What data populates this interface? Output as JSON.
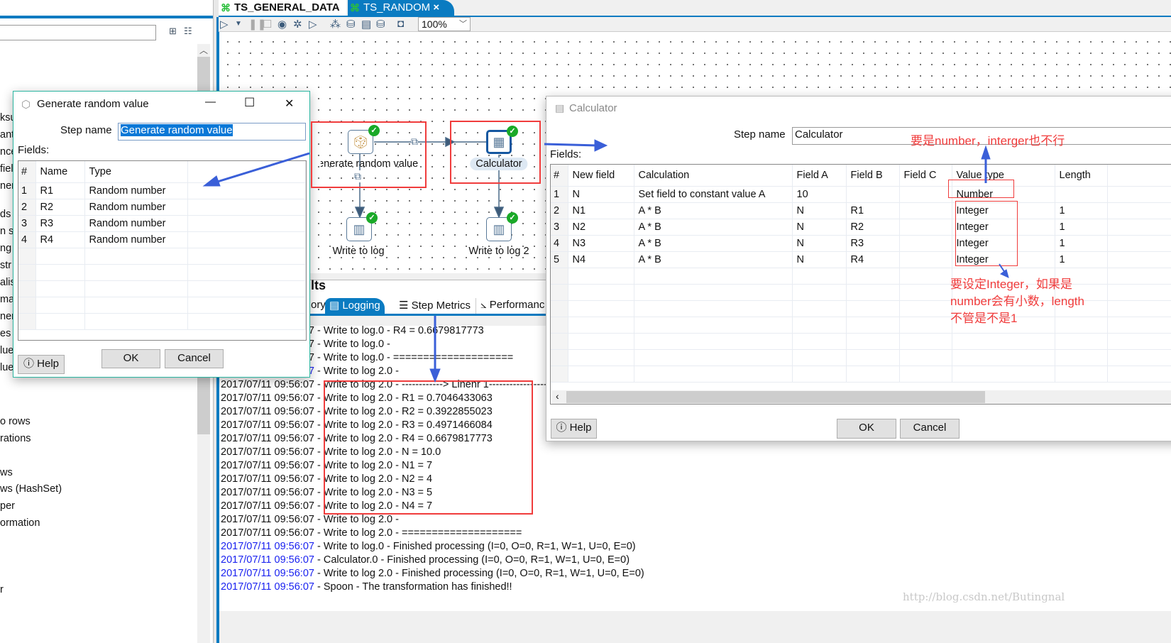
{
  "left_panel": {
    "items_top": [
      "ksu",
      "ant",
      "nce",
      "fiel",
      "ner",
      "ds",
      "n sl",
      "ng",
      "str",
      "alis",
      "ma",
      "ner",
      "es",
      "lue",
      "lue"
    ],
    "items_bottom": [
      "o rows",
      "rations",
      "ws",
      "ws (HashSet)",
      "per",
      "ormation",
      "r"
    ]
  },
  "tabs": [
    {
      "label": "TS_GENERAL_DATA",
      "active": false
    },
    {
      "label": "TS_RANDOM",
      "active": true,
      "close": "×"
    }
  ],
  "toolbar": {
    "zoom": "100%",
    "icons": [
      "run-icon",
      "dropdown-icon",
      "pause-icon",
      "stop-icon",
      "preview-icon",
      "debug-icon",
      "replay-icon",
      "verify-icon",
      "impact-icon",
      "sql-icon",
      "explore-db-icon",
      "show-results-icon"
    ]
  },
  "canvas": {
    "steps": [
      {
        "label": "Generate random value",
        "icon": "dice-icon"
      },
      {
        "label": "Calculator",
        "icon": "calculator-icon"
      },
      {
        "label": "Write to log",
        "icon": "log-icon"
      },
      {
        "label": "Write to log 2",
        "icon": "log-icon"
      }
    ]
  },
  "results": {
    "title": "lts",
    "tabs": [
      "ory",
      "Logging",
      "Step Metrics",
      "Performanc"
    ],
    "log": [
      {
        "ts": "2017/07/11 09:56:07",
        "blue": false,
        "text": " - Write to log.0 - R4 = 0.6679817773"
      },
      {
        "ts": "2017/07/11 09:56:07",
        "blue": false,
        "text": " - Write to log.0 - "
      },
      {
        "ts": "2017/07/11 09:56:07",
        "blue": false,
        "text": " - Write to log.0 - ===================="
      },
      {
        "ts": "2017/07/11 09:56:07",
        "blue": true,
        "text": " - Write to log 2.0 - "
      },
      {
        "ts": "2017/07/11 09:56:07",
        "blue": false,
        "text": " - Write to log 2.0 - ------------> Linenr 1------------------------"
      },
      {
        "ts": "2017/07/11 09:56:07",
        "blue": false,
        "text": " - Write to log 2.0 - R1 = 0.7046433063"
      },
      {
        "ts": "2017/07/11 09:56:07",
        "blue": false,
        "text": " - Write to log 2.0 - R2 = 0.3922855023"
      },
      {
        "ts": "2017/07/11 09:56:07",
        "blue": false,
        "text": " - Write to log 2.0 - R3 = 0.4971466084"
      },
      {
        "ts": "2017/07/11 09:56:07",
        "blue": false,
        "text": " - Write to log 2.0 - R4 = 0.6679817773"
      },
      {
        "ts": "2017/07/11 09:56:07",
        "blue": false,
        "text": " - Write to log 2.0 - N = 10.0"
      },
      {
        "ts": "2017/07/11 09:56:07",
        "blue": false,
        "text": " - Write to log 2.0 - N1 = 7"
      },
      {
        "ts": "2017/07/11 09:56:07",
        "blue": false,
        "text": " - Write to log 2.0 - N2 = 4"
      },
      {
        "ts": "2017/07/11 09:56:07",
        "blue": false,
        "text": " - Write to log 2.0 - N3 = 5"
      },
      {
        "ts": "2017/07/11 09:56:07",
        "blue": false,
        "text": " - Write to log 2.0 - N4 = 7"
      },
      {
        "ts": "2017/07/11 09:56:07",
        "blue": false,
        "text": " - Write to log 2.0 - "
      },
      {
        "ts": "2017/07/11 09:56:07",
        "blue": false,
        "text": " - Write to log 2.0 - ===================="
      },
      {
        "ts": "2017/07/11 09:56:07",
        "blue": true,
        "text": " - Write to log.0 - Finished processing (I=0, O=0, R=1, W=1, U=0, E=0)"
      },
      {
        "ts": "2017/07/11 09:56:07",
        "blue": true,
        "text": " - Calculator.0 - Finished processing (I=0, O=0, R=1, W=1, U=0, E=0)"
      },
      {
        "ts": "2017/07/11 09:56:07",
        "blue": true,
        "text": " - Write to log 2.0 - Finished processing (I=0, O=0, R=1, W=1, U=0, E=0)"
      },
      {
        "ts": "2017/07/11 09:56:07",
        "blue": true,
        "text": " - Spoon - The transformation has finished!!"
      }
    ]
  },
  "watermark": "http://blog.csdn.net/Butingnal",
  "gen_dialog": {
    "title": "Generate random value",
    "minimize": "—",
    "maximize": "☐",
    "close": "✕",
    "step_name_label": "Step name",
    "step_name": "Generate random value",
    "fields_label": "Fields:",
    "columns": [
      "#",
      "Name",
      "Type"
    ],
    "rows": [
      [
        "1",
        "R1",
        "Random number"
      ],
      [
        "2",
        "R2",
        "Random number"
      ],
      [
        "3",
        "R3",
        "Random number"
      ],
      [
        "4",
        "R4",
        "Random number"
      ]
    ],
    "help": "Help",
    "ok": "OK",
    "cancel": "Cancel"
  },
  "calc_dialog": {
    "title": "Calculator",
    "step_name_label": "Step name",
    "step_name": "Calculator",
    "fields_label": "Fields:",
    "columns": [
      "#",
      "New field",
      "Calculation",
      "Field A",
      "Field B",
      "Field C",
      "Value type",
      "Length"
    ],
    "rows": [
      [
        "1",
        "N",
        "Set field to constant value A",
        "10",
        "",
        "",
        "Number",
        ""
      ],
      [
        "2",
        "N1",
        "A * B",
        "N",
        "R1",
        "",
        "Integer",
        "1"
      ],
      [
        "3",
        "N2",
        "A * B",
        "N",
        "R2",
        "",
        "Integer",
        "1"
      ],
      [
        "4",
        "N3",
        "A * B",
        "N",
        "R3",
        "",
        "Integer",
        "1"
      ],
      [
        "5",
        "N4",
        "A * B",
        "N",
        "R4",
        "",
        "Integer",
        "1"
      ]
    ],
    "help": "Help",
    "ok": "OK",
    "cancel": "Cancel"
  },
  "annotations": {
    "note1": "要是number，interger也不行",
    "note2": [
      "要设定Integer，如果是",
      "number会有小数，length",
      "不管是不是1"
    ],
    "color": "#f03c3c",
    "arrow_color": "#3a5fd8"
  }
}
